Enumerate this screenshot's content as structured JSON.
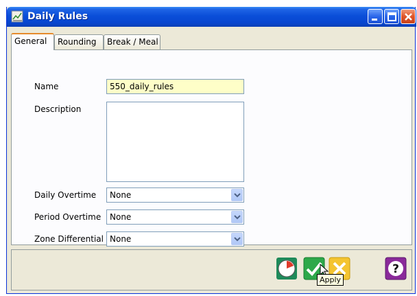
{
  "window": {
    "title": "Daily Rules"
  },
  "tabs": [
    {
      "label": "General",
      "active": true
    },
    {
      "label": "Rounding",
      "active": false
    },
    {
      "label": "Break / Meal",
      "active": false
    }
  ],
  "form": {
    "name_label": "Name",
    "name_value": "550_daily_rules",
    "description_label": "Description",
    "description_value": "",
    "daily_overtime_label": "Daily Overtime",
    "daily_overtime_value": "None",
    "period_overtime_label": "Period Overtime",
    "period_overtime_value": "None",
    "zone_differential_label": "Zone Differential",
    "zone_differential_value": "None"
  },
  "toolbar": {
    "apply_tooltip": "Apply"
  },
  "icons": {
    "window_icon": "chart-icon",
    "minimize": "minimize-icon",
    "maximize": "maximize-icon",
    "close": "close-icon",
    "history": "clock-icon",
    "apply": "checkmark-icon",
    "cancel": "cancel-icon",
    "help": "help-icon"
  },
  "colors": {
    "titlebar": "#0a4ed8",
    "required_field": "#fefec8",
    "active_tab_accent": "#e68b2c"
  }
}
